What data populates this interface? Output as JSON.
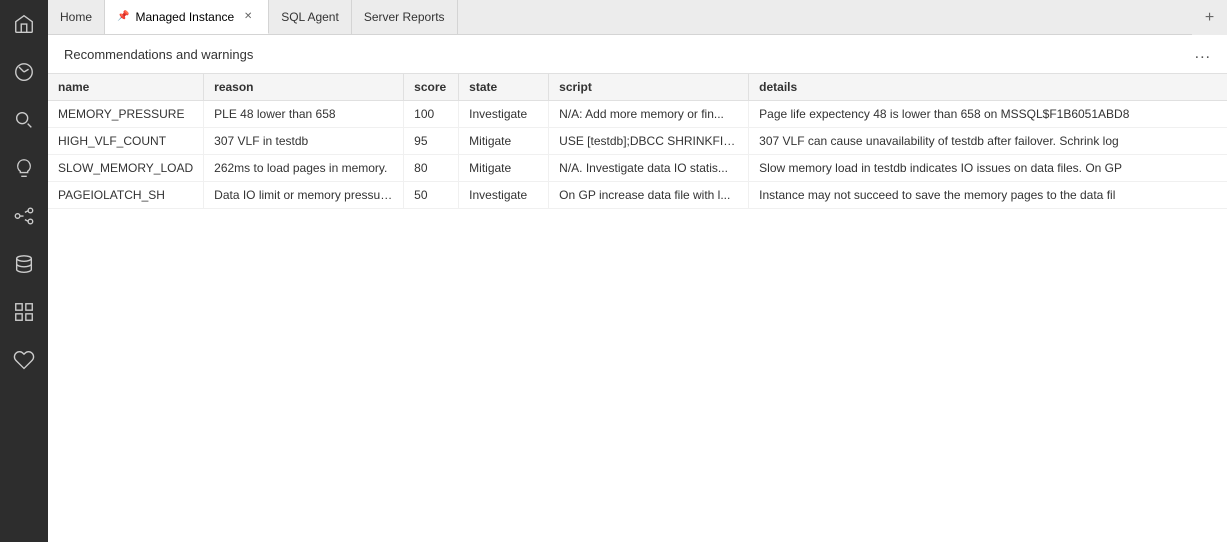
{
  "activityBar": {
    "items": [
      {
        "name": "home-icon",
        "label": "Home"
      },
      {
        "name": "dashboard-icon",
        "label": "Dashboard"
      },
      {
        "name": "search-icon",
        "label": "Search"
      },
      {
        "name": "lightbulb-icon",
        "label": "Recommendations"
      },
      {
        "name": "connections-icon",
        "label": "Connections"
      },
      {
        "name": "database-icon",
        "label": "Databases"
      },
      {
        "name": "grid-icon",
        "label": "Grid"
      },
      {
        "name": "heart-icon",
        "label": "Favorites"
      }
    ]
  },
  "tabs": [
    {
      "id": "home",
      "label": "Home",
      "active": false,
      "closeable": false,
      "pinned": false
    },
    {
      "id": "managed-instance",
      "label": "Managed Instance",
      "active": true,
      "closeable": true,
      "pinned": true
    },
    {
      "id": "sql-agent",
      "label": "SQL Agent",
      "active": false,
      "closeable": false,
      "pinned": false
    },
    {
      "id": "server-reports",
      "label": "Server Reports",
      "active": false,
      "closeable": false,
      "pinned": false
    }
  ],
  "panel": {
    "title": "Recommendations and warnings",
    "menu_label": "..."
  },
  "table": {
    "columns": [
      {
        "id": "name",
        "label": "name"
      },
      {
        "id": "reason",
        "label": "reason"
      },
      {
        "id": "score",
        "label": "score"
      },
      {
        "id": "state",
        "label": "state"
      },
      {
        "id": "script",
        "label": "script"
      },
      {
        "id": "details",
        "label": "details"
      }
    ],
    "rows": [
      {
        "name": "MEMORY_PRESSURE",
        "reason": "PLE 48 lower than 658",
        "score": "100",
        "state": "Investigate",
        "script": "N/A: Add more memory or fin...",
        "details": "Page life expectency 48 is lower than 658 on MSSQL$F1B6051ABD8"
      },
      {
        "name": "HIGH_VLF_COUNT",
        "reason": "307 VLF in testdb",
        "score": "95",
        "state": "Mitigate",
        "script": "USE [testdb];DBCC SHRINKFIL...",
        "details": "307 VLF can cause unavailability of testdb after failover. Schrink log"
      },
      {
        "name": "SLOW_MEMORY_LOAD",
        "reason": "262ms to load pages in memory.",
        "score": "80",
        "state": "Mitigate",
        "script": "N/A. Investigate data IO statis...",
        "details": "Slow memory load in testdb indicates IO issues on data files. On GP"
      },
      {
        "name": "PAGEIOLATCH_SH",
        "reason": "Data IO limit or memory pressure.",
        "score": "50",
        "state": "Investigate",
        "script": "On GP increase data file with l...",
        "details": "Instance may not succeed to save the memory pages to the data fil"
      }
    ]
  }
}
